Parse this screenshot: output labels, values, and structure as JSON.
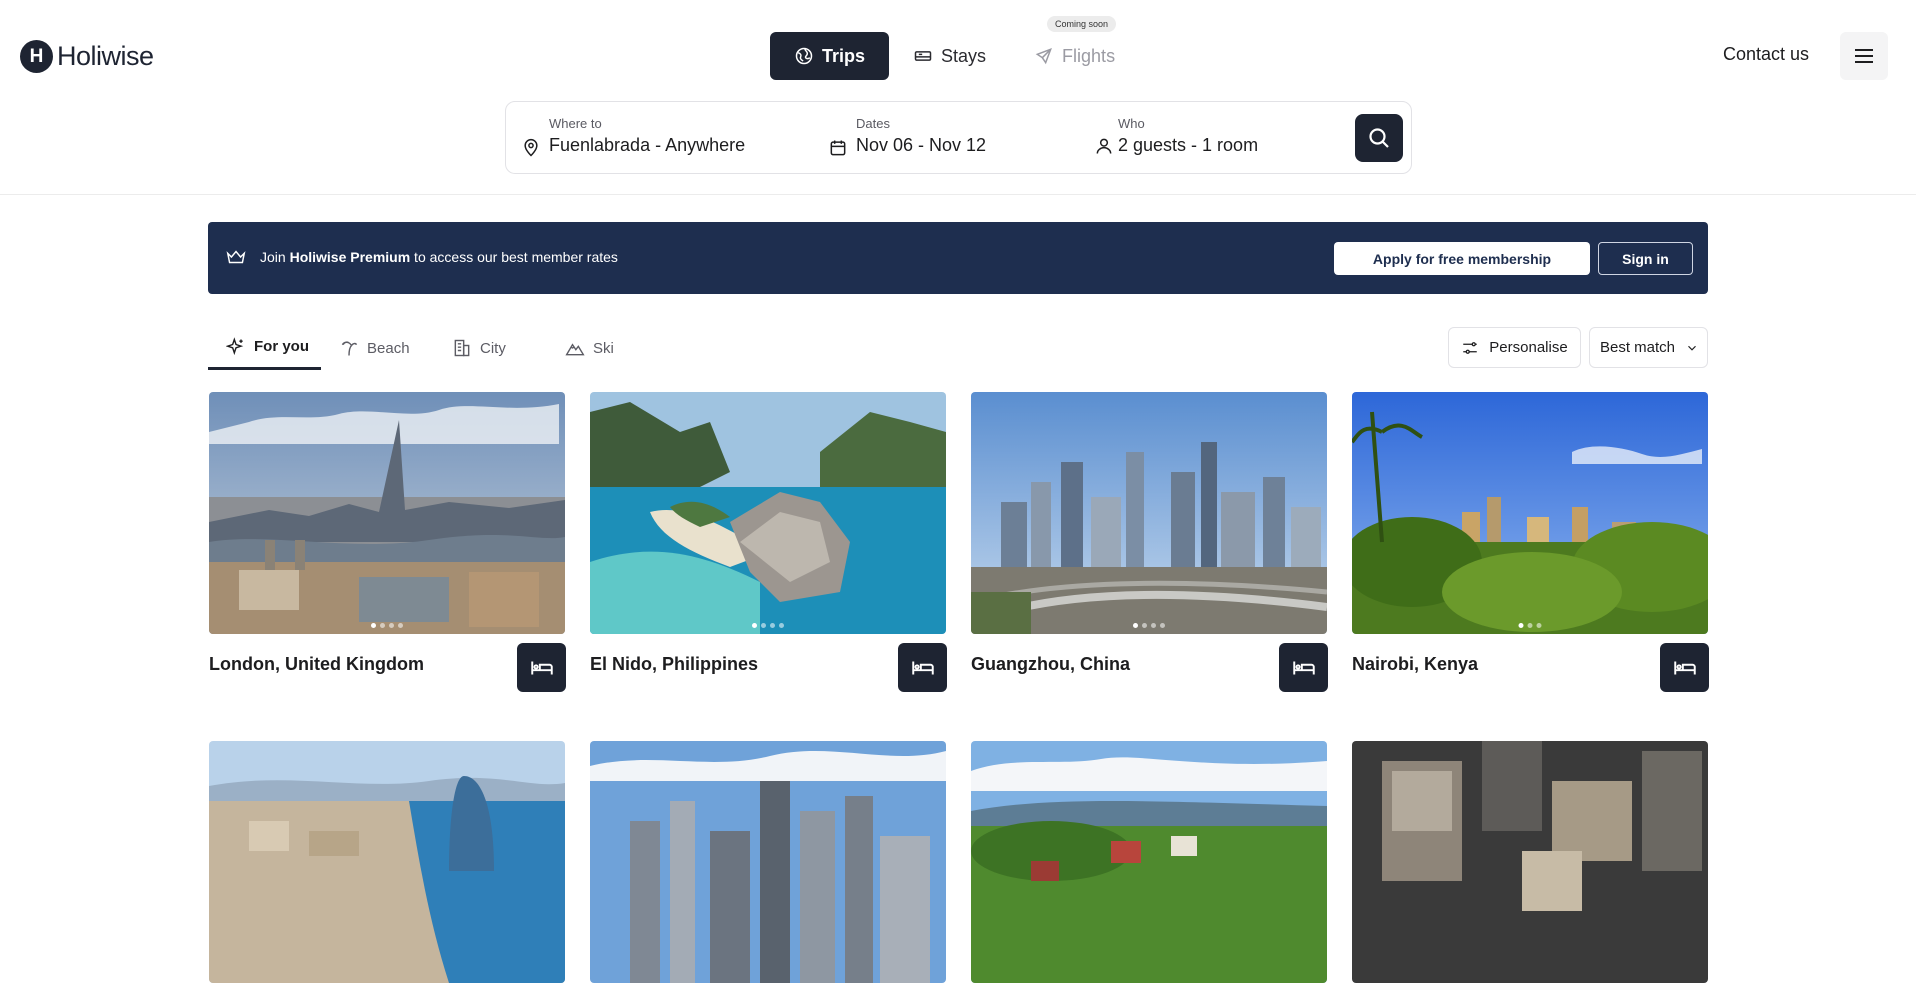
{
  "brand": {
    "mark": "H",
    "name": "Holiwise"
  },
  "nav": {
    "tabs": [
      {
        "label": "Trips",
        "icon": "globe-icon",
        "active": true
      },
      {
        "label": "Stays",
        "icon": "bed-icon",
        "active": false
      },
      {
        "label": "Flights",
        "icon": "plane-icon",
        "active": false
      }
    ],
    "coming_soon": "Coming soon",
    "contact": "Contact us"
  },
  "search": {
    "where_label": "Where to",
    "where_value": "Fuenlabrada - Anywhere",
    "dates_label": "Dates",
    "dates_value": "Nov 06 - Nov 12",
    "who_label": "Who",
    "who_value": "2 guests - 1 room"
  },
  "banner": {
    "text_before": "Join ",
    "text_brand": "Holiwise Premium",
    "text_after": " to access our best member rates",
    "apply_label": "Apply for free membership",
    "signin_label": "Sign in"
  },
  "categories": [
    {
      "label": "For you",
      "icon": "sparkle-icon",
      "active": true
    },
    {
      "label": "Beach",
      "icon": "palm-icon",
      "active": false
    },
    {
      "label": "City",
      "icon": "building-icon",
      "active": false
    },
    {
      "label": "Ski",
      "icon": "mountain-icon",
      "active": false
    }
  ],
  "filters": {
    "personalise_label": "Personalise",
    "sort_label": "Best match"
  },
  "destinations": [
    {
      "title": "London, United Kingdom"
    },
    {
      "title": "El Nido, Philippines"
    },
    {
      "title": "Guangzhou, China"
    },
    {
      "title": "Nairobi, Kenya"
    }
  ],
  "colors": {
    "primary": "#1e2432",
    "banner": "#1e2e4f",
    "border": "#e2e2e6"
  }
}
